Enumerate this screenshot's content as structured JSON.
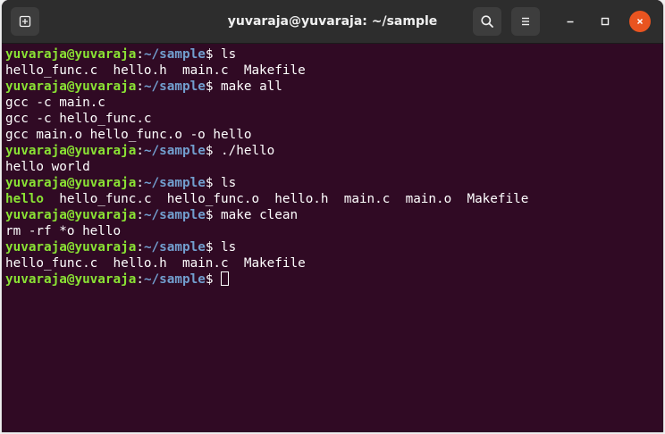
{
  "window": {
    "title": "yuvaraja@yuvaraja: ~/sample"
  },
  "prompt": {
    "user": "yuvaraja@yuvaraja",
    "sep": ":",
    "path": "~/sample",
    "symbol": "$ "
  },
  "terminal": {
    "lines": [
      {
        "type": "prompt",
        "command": "ls"
      },
      {
        "type": "output",
        "text": "hello_func.c  hello.h  main.c  Makefile"
      },
      {
        "type": "prompt",
        "command": "make all"
      },
      {
        "type": "output",
        "text": "gcc -c main.c"
      },
      {
        "type": "output",
        "text": "gcc -c hello_func.c"
      },
      {
        "type": "output",
        "text": "gcc main.o hello_func.o -o hello"
      },
      {
        "type": "prompt",
        "command": "./hello"
      },
      {
        "type": "output",
        "text": "hello world"
      },
      {
        "type": "prompt",
        "command": "ls"
      },
      {
        "type": "listing",
        "exe": "hello",
        "rest": "  hello_func.c  hello_func.o  hello.h  main.c  main.o  Makefile"
      },
      {
        "type": "prompt",
        "command": "make clean"
      },
      {
        "type": "output",
        "text": "rm -rf *o hello"
      },
      {
        "type": "prompt",
        "command": "ls"
      },
      {
        "type": "output",
        "text": "hello_func.c  hello.h  main.c  Makefile"
      },
      {
        "type": "prompt",
        "command": "",
        "cursor": true
      }
    ]
  },
  "icons": {
    "new_tab": "new-tab-icon",
    "search": "search-icon",
    "menu": "hamburger-menu-icon",
    "minimize": "minimize-icon",
    "maximize": "maximize-icon",
    "close": "close-icon"
  },
  "colors": {
    "background": "#300a24",
    "titlebar": "#2d2d2d",
    "prompt_user": "#8ae234",
    "prompt_path": "#729fcf",
    "executable": "#8ae234",
    "text": "#ffffff",
    "close_button": "#e95420"
  }
}
